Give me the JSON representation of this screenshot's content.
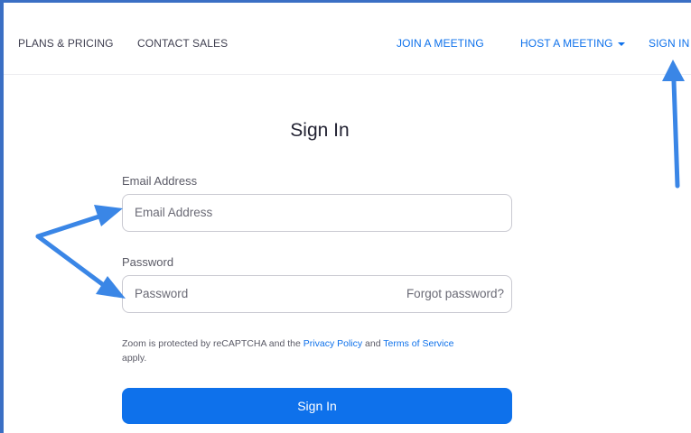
{
  "nav": {
    "plans_pricing": "PLANS & PRICING",
    "contact_sales": "CONTACT SALES",
    "join_meeting": "JOIN A MEETING",
    "host_meeting": "HOST A MEETING",
    "sign_in": "SIGN IN"
  },
  "form": {
    "title": "Sign In",
    "email_label": "Email Address",
    "email_placeholder": "Email Address",
    "password_label": "Password",
    "password_placeholder": "Password",
    "forgot_password": "Forgot password?",
    "recaptcha": {
      "prefix": "Zoom is protected by reCAPTCHA and the ",
      "privacy_policy": "Privacy Policy",
      "and": " and ",
      "terms_of_service": "Terms of Service",
      "suffix": "apply."
    },
    "submit_label": "Sign In"
  },
  "colors": {
    "accent": "#0e71eb",
    "annotation_arrow": "#3a86e6"
  }
}
